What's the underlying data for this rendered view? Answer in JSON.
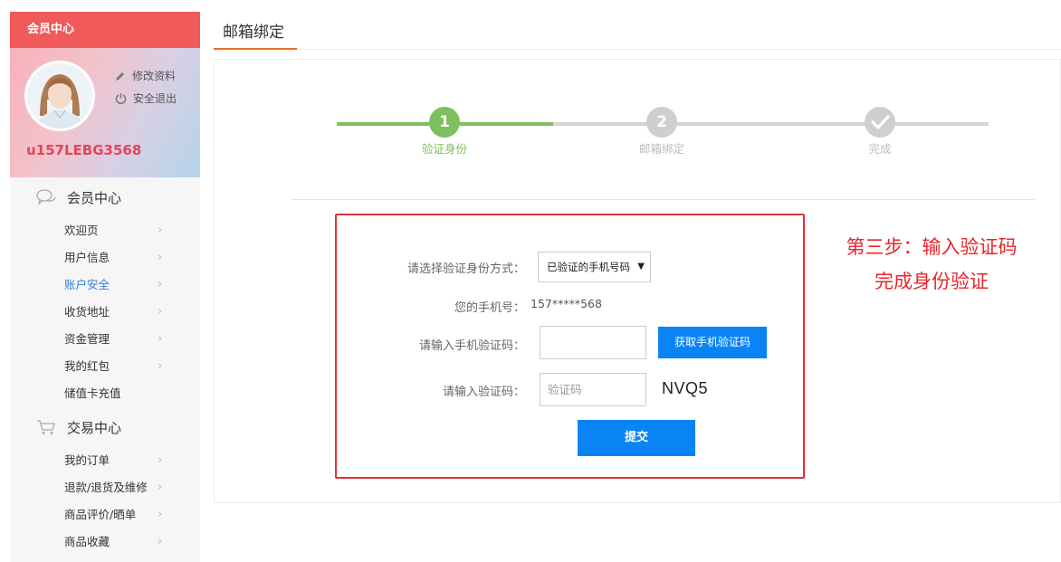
{
  "sidebar": {
    "header": "会员中心",
    "profile": {
      "edit_label": "修改资料",
      "logout_label": "安全退出",
      "username": "u157LEBG3568"
    },
    "sections": [
      {
        "title": "会员中心",
        "icon": "chat-bubbles-icon",
        "items": [
          {
            "label": "欢迎页"
          },
          {
            "label": "用户信息"
          },
          {
            "label": "账户安全",
            "active": true
          },
          {
            "label": "收货地址"
          },
          {
            "label": "资金管理"
          },
          {
            "label": "我的红包"
          },
          {
            "label": "储值卡充值"
          }
        ]
      },
      {
        "title": "交易中心",
        "icon": "shopping-cart-icon",
        "items": [
          {
            "label": "我的订单"
          },
          {
            "label": "退款/退货及维修"
          },
          {
            "label": "商品评价/晒单"
          },
          {
            "label": "商品收藏"
          }
        ]
      }
    ]
  },
  "main": {
    "title": "邮箱绑定",
    "steps": [
      {
        "number": "1",
        "label": "验证身份",
        "state": "active"
      },
      {
        "number": "2",
        "label": "邮箱绑定",
        "state": "pending"
      },
      {
        "number": "",
        "label": "完成",
        "state": "pending"
      }
    ],
    "form": {
      "method_label": "请选择验证身份方式：",
      "method_value": "已验证的手机号码",
      "phone_label": "您的手机号：",
      "phone_value": "157*****568",
      "sms_label": "请输入手机验证码：",
      "sms_button": "获取手机验证码",
      "code_label": "请输入验证码：",
      "code_placeholder": "验证码",
      "captcha_text": "NVQ5",
      "submit_label": "提交"
    },
    "annotation": {
      "line1": "第三步：输入验证码",
      "line2": "完成身份验证"
    }
  },
  "colors": {
    "sidebar_header": "#f05a5a",
    "accent_orange": "#e3722c",
    "step_active": "#7dc05f",
    "step_pending": "#cfcfcf",
    "primary_button": "#0a84f5",
    "highlight_red": "#e23232",
    "active_link": "#2f7fe3"
  }
}
